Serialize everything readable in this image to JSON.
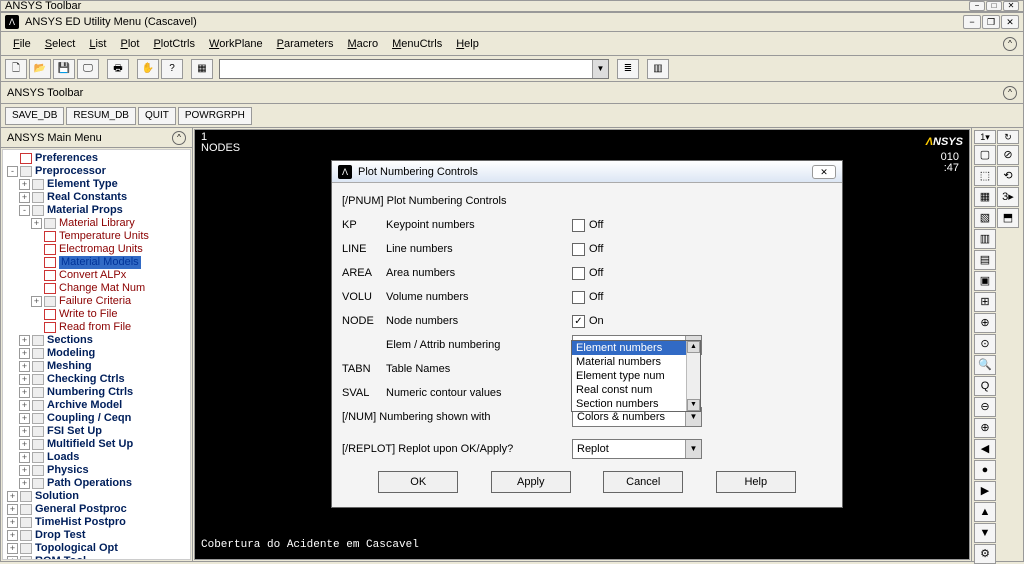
{
  "outer_title": "ANSYS Toolbar",
  "title": "ANSYS ED Utility Menu (Cascavel)",
  "menus": [
    "File",
    "Select",
    "List",
    "Plot",
    "PlotCtrls",
    "WorkPlane",
    "Parameters",
    "Macro",
    "MenuCtrls",
    "Help"
  ],
  "toolbar2_label": "ANSYS Toolbar",
  "toolbar3": [
    "SAVE_DB",
    "RESUM_DB",
    "QUIT",
    "POWRGRPH"
  ],
  "sidebar_title": "ANSYS Main Menu",
  "tree": [
    {
      "ind": 0,
      "exp": "",
      "icon": 1,
      "label": "Preferences",
      "cls": "bold"
    },
    {
      "ind": 0,
      "exp": "-",
      "icon": 0,
      "label": "Preprocessor",
      "cls": "bold"
    },
    {
      "ind": 1,
      "exp": "+",
      "icon": 0,
      "label": "Element Type",
      "cls": "bold"
    },
    {
      "ind": 1,
      "exp": "+",
      "icon": 0,
      "label": "Real Constants",
      "cls": "bold"
    },
    {
      "ind": 1,
      "exp": "-",
      "icon": 0,
      "label": "Material Props",
      "cls": "bold"
    },
    {
      "ind": 2,
      "exp": "+",
      "icon": 0,
      "label": "Material Library",
      "cls": "darkred"
    },
    {
      "ind": 2,
      "exp": "",
      "icon": 1,
      "label": "Temperature Units",
      "cls": "darkred"
    },
    {
      "ind": 2,
      "exp": "",
      "icon": 1,
      "label": "Electromag Units",
      "cls": "darkred"
    },
    {
      "ind": 2,
      "exp": "",
      "icon": 1,
      "label": "Material Models",
      "cls": "normal",
      "selected": true
    },
    {
      "ind": 2,
      "exp": "",
      "icon": 1,
      "label": "Convert ALPx",
      "cls": "darkred"
    },
    {
      "ind": 2,
      "exp": "",
      "icon": 1,
      "label": "Change Mat Num",
      "cls": "darkred"
    },
    {
      "ind": 2,
      "exp": "+",
      "icon": 0,
      "label": "Failure Criteria",
      "cls": "darkred"
    },
    {
      "ind": 2,
      "exp": "",
      "icon": 1,
      "label": "Write to File",
      "cls": "darkred"
    },
    {
      "ind": 2,
      "exp": "",
      "icon": 1,
      "label": "Read from File",
      "cls": "darkred"
    },
    {
      "ind": 1,
      "exp": "+",
      "icon": 0,
      "label": "Sections",
      "cls": "bold"
    },
    {
      "ind": 1,
      "exp": "+",
      "icon": 0,
      "label": "Modeling",
      "cls": "bold"
    },
    {
      "ind": 1,
      "exp": "+",
      "icon": 0,
      "label": "Meshing",
      "cls": "bold"
    },
    {
      "ind": 1,
      "exp": "+",
      "icon": 0,
      "label": "Checking Ctrls",
      "cls": "bold"
    },
    {
      "ind": 1,
      "exp": "+",
      "icon": 0,
      "label": "Numbering Ctrls",
      "cls": "bold"
    },
    {
      "ind": 1,
      "exp": "+",
      "icon": 0,
      "label": "Archive Model",
      "cls": "bold"
    },
    {
      "ind": 1,
      "exp": "+",
      "icon": 0,
      "label": "Coupling / Ceqn",
      "cls": "bold"
    },
    {
      "ind": 1,
      "exp": "+",
      "icon": 0,
      "label": "FSI Set Up",
      "cls": "bold"
    },
    {
      "ind": 1,
      "exp": "+",
      "icon": 0,
      "label": "Multifield Set Up",
      "cls": "bold"
    },
    {
      "ind": 1,
      "exp": "+",
      "icon": 0,
      "label": "Loads",
      "cls": "bold"
    },
    {
      "ind": 1,
      "exp": "+",
      "icon": 0,
      "label": "Physics",
      "cls": "bold"
    },
    {
      "ind": 1,
      "exp": "+",
      "icon": 0,
      "label": "Path Operations",
      "cls": "bold"
    },
    {
      "ind": 0,
      "exp": "+",
      "icon": 0,
      "label": "Solution",
      "cls": "bold"
    },
    {
      "ind": 0,
      "exp": "+",
      "icon": 0,
      "label": "General Postproc",
      "cls": "bold"
    },
    {
      "ind": 0,
      "exp": "+",
      "icon": 0,
      "label": "TimeHist Postpro",
      "cls": "bold"
    },
    {
      "ind": 0,
      "exp": "+",
      "icon": 0,
      "label": "Drop Test",
      "cls": "bold"
    },
    {
      "ind": 0,
      "exp": "+",
      "icon": 0,
      "label": "Topological Opt",
      "cls": "bold"
    },
    {
      "ind": 0,
      "exp": "+",
      "icon": 0,
      "label": "ROM Tool",
      "cls": "bold"
    }
  ],
  "graphics": {
    "corner1": "1",
    "corner2": "NODES",
    "logo": "NSYS",
    "meta1": "010",
    "meta2": ":47",
    "footer": "Cobertura do Acidente em Cascavel"
  },
  "dialog": {
    "title": "Plot Numbering Controls",
    "header": "[/PNUM]  Plot Numbering Controls",
    "rows": [
      {
        "code": "KP",
        "label": "Keypoint numbers",
        "type": "check",
        "checked": false,
        "val": "Off"
      },
      {
        "code": "LINE",
        "label": "Line numbers",
        "type": "check",
        "checked": false,
        "val": "Off"
      },
      {
        "code": "AREA",
        "label": "Area numbers",
        "type": "check",
        "checked": false,
        "val": "Off"
      },
      {
        "code": "VOLU",
        "label": "Volume numbers",
        "type": "check",
        "checked": false,
        "val": "Off"
      },
      {
        "code": "NODE",
        "label": "Node numbers",
        "type": "check",
        "checked": true,
        "val": "On"
      },
      {
        "code": "",
        "label": "Elem / Attrib numbering",
        "type": "select",
        "val": "Element numbers",
        "indent": true
      },
      {
        "code": "TABN",
        "label": "Table Names",
        "type": "none"
      },
      {
        "code": "SVAL",
        "label": "Numeric contour values",
        "type": "none"
      },
      {
        "code": "",
        "label": "[/NUM]  Numbering shown with",
        "type": "select",
        "val": "Colors & numbers",
        "full": true
      },
      {
        "code": "",
        "label": " ",
        "type": "spacer"
      },
      {
        "code": "",
        "label": "[/REPLOT] Replot upon OK/Apply?",
        "type": "select",
        "val": "Replot",
        "full": true
      }
    ],
    "dropdown": [
      "Element numbers",
      "Material numbers",
      "Element type num",
      "Real const num",
      "Section numbers"
    ],
    "dropdown_selected": 0,
    "buttons": [
      "OK",
      "Apply",
      "Cancel",
      "Help"
    ]
  },
  "right_tools_top": [
    [
      "1▾",
      "↻"
    ]
  ],
  "right_tools": [
    [
      "▢",
      "⊘"
    ],
    [
      "⬚",
      "⟲"
    ],
    [
      "▦",
      "3▸"
    ],
    [
      "▧",
      "⬒"
    ],
    [
      "▥",
      ""
    ],
    [
      "▤",
      ""
    ],
    [
      "▣",
      ""
    ],
    [
      "⊞",
      ""
    ],
    [
      "⊕",
      ""
    ],
    [
      "⊙",
      ""
    ],
    [
      "🔍",
      ""
    ],
    [
      "Q",
      ""
    ],
    [
      "⊖",
      ""
    ],
    [
      "⊕",
      ""
    ],
    [
      "◀",
      ""
    ],
    [
      "●",
      ""
    ],
    [
      "▶",
      ""
    ],
    [
      "▲",
      ""
    ],
    [
      "▼",
      ""
    ],
    [
      "⚙",
      ""
    ]
  ]
}
